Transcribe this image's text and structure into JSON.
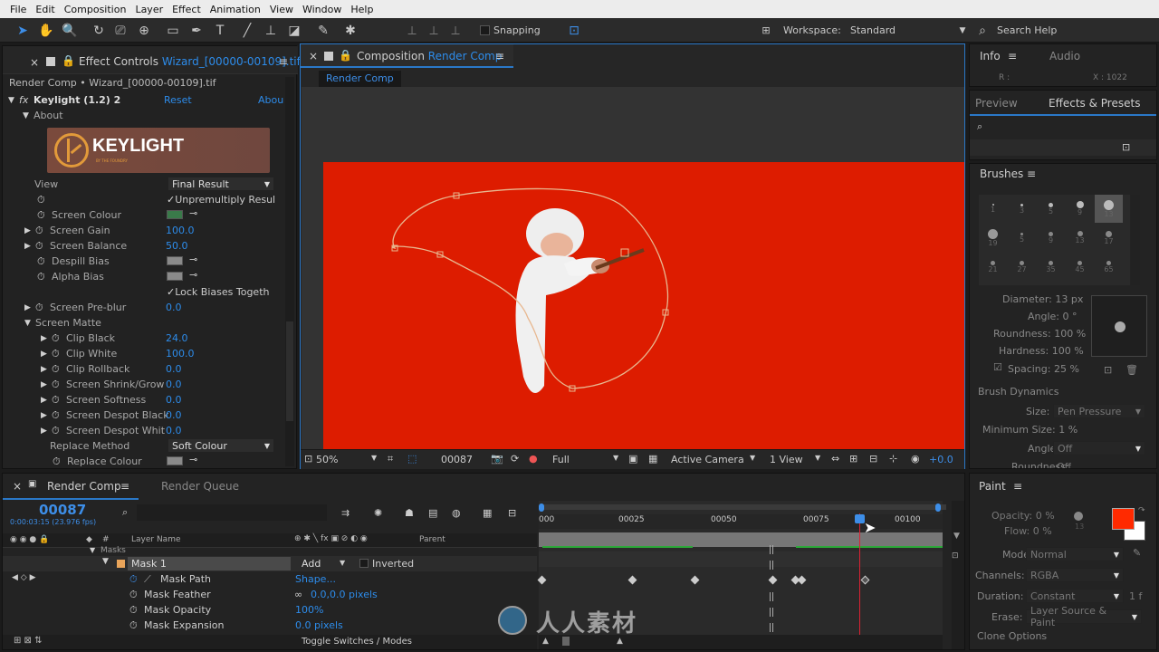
{
  "menu": [
    "File",
    "Edit",
    "Composition",
    "Layer",
    "Effect",
    "Animation",
    "View",
    "Window",
    "Help"
  ],
  "toolbar": {
    "snapping": "Snapping",
    "workspace_label": "Workspace:",
    "workspace_value": "Standard",
    "search_help": "Search Help"
  },
  "effect_controls": {
    "tab_label": "Effect Controls",
    "tab_file": "Wizard_[00000-00109].tif",
    "path": "Render Comp • Wizard_[00000-00109].tif",
    "effect_name": "Keylight (1.2) 2",
    "reset": "Reset",
    "about_link": "Abou",
    "about": "About",
    "logo_text": "KEYLIGHT",
    "logo_sub": "BY THE FOUNDRY",
    "view_label": "View",
    "view_value": "Final Result",
    "unpremult": "Unpremultiply Resul",
    "screen_colour": "Screen Colour",
    "screen_colour_hex": "#3a7a4a",
    "screen_gain": "Screen Gain",
    "screen_gain_val": "100.0",
    "screen_balance": "Screen Balance",
    "screen_balance_val": "50.0",
    "despill_bias": "Despill Bias",
    "alpha_bias": "Alpha Bias",
    "lock_biases": "Lock Biases Togeth",
    "screen_preblur": "Screen Pre-blur",
    "screen_preblur_val": "0.0",
    "screen_matte": "Screen Matte",
    "clip_black": "Clip Black",
    "clip_black_val": "24.0",
    "clip_white": "Clip White",
    "clip_white_val": "100.0",
    "clip_rollback": "Clip Rollback",
    "clip_rollback_val": "0.0",
    "shrink_grow": "Screen Shrink/Grow",
    "shrink_grow_val": "0.0",
    "softness": "Screen Softness",
    "softness_val": "0.0",
    "despot_black": "Screen Despot Black",
    "despot_black_val": "0.0",
    "despot_white": "Screen Despot Whit",
    "despot_white_val": "0.0",
    "replace_method": "Replace Method",
    "replace_method_val": "Soft Colour",
    "replace_colour": "Replace Colour"
  },
  "composition": {
    "tab_label": "Composition",
    "tab_comp": "Render Comp",
    "breadcrumb": "Render Comp",
    "bg_color": "#dd1c00",
    "zoom": "50%",
    "frame": "00087",
    "resolution": "Full",
    "camera": "Active Camera",
    "views": "1 View",
    "exposure": "+0.0"
  },
  "right": {
    "info": "Info",
    "audio": "Audio",
    "info_r": "R :",
    "info_x": "X : 1022",
    "preview": "Preview",
    "effects_presets": "Effects & Presets",
    "brushes": "Brushes",
    "brush_sizes": [
      "1",
      "3",
      "5",
      "9",
      "13",
      "19",
      "5",
      "9",
      "13",
      "17",
      "21",
      "27",
      "35",
      "45",
      "65"
    ],
    "diameter": "Diameter: 13 px",
    "angle": "Angle: 0 °",
    "roundness": "Roundness: 100 %",
    "hardness": "Hardness: 100 %",
    "spacing": "Spacing: 25 %",
    "brush_dynamics": "Brush Dynamics",
    "size_label": "Size:",
    "size_val": "Pen Pressure",
    "min_size": "Minimum Size: 1 %",
    "angle2_label": "Angle:",
    "angle2_val": "Off",
    "roundness2": "Roundness:",
    "roundness2_val": "Off",
    "paint": "Paint",
    "opacity": "Opacity: 0 %",
    "flow": "Flow: 0 %",
    "brush_num": "13",
    "mode_label": "Mode:",
    "mode_val": "Normal",
    "channels_label": "Channels:",
    "channels_val": "RGBA",
    "duration_label": "Duration:",
    "duration_val": "Constant",
    "duration_num": "1 f",
    "erase_label": "Erase:",
    "erase_val": "Layer Source & Paint",
    "clone_options": "Clone Options",
    "fg_color": "#ff2a00",
    "bg_color": "#ffffff"
  },
  "timeline": {
    "tab_label": "Render Comp",
    "render_queue": "Render Queue",
    "timecode": "00087",
    "timecode_sub": "0:00:03:15 (23.976 fps)",
    "col_layer_name": "Layer Name",
    "col_parent": "Parent",
    "masks": "Masks",
    "mask1": "Mask 1",
    "mask_mode": "Add",
    "inverted": "Inverted",
    "mask_path": "Mask Path",
    "mask_path_val": "Shape...",
    "mask_feather": "Mask Feather",
    "mask_feather_val": "0.0,0.0 pixels",
    "mask_opacity": "Mask Opacity",
    "mask_opacity_val": "100%",
    "mask_expansion": "Mask Expansion",
    "mask_expansion_val": "0.0 pixels",
    "toggle": "Toggle Switches / Modes",
    "ruler": [
      "000",
      "00025",
      "00050",
      "00075",
      "00100"
    ]
  },
  "watermark": "人人素材"
}
